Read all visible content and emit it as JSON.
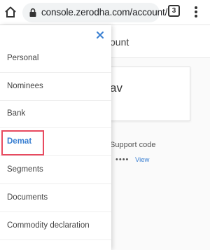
{
  "browser": {
    "url": "console.zerodha.com/account/",
    "tab_count": "3"
  },
  "page": {
    "header_partial": "ount",
    "card_name_partial": "av",
    "support_code_label": "Support code",
    "support_code_masked": "••••",
    "view_link": "View"
  },
  "drawer": {
    "items": [
      {
        "label": "Personal"
      },
      {
        "label": "Nominees"
      },
      {
        "label": "Bank"
      },
      {
        "label": "Demat"
      },
      {
        "label": "Segments"
      },
      {
        "label": "Documents"
      },
      {
        "label": "Commodity declaration"
      }
    ],
    "active_item": "Demat"
  },
  "colors": {
    "accent": "#387ed1",
    "highlight": "#e84a5f"
  }
}
